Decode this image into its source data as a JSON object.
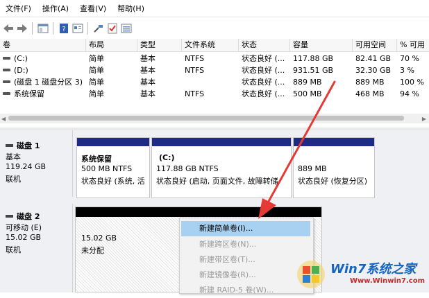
{
  "menu": [
    "文件(F)",
    "操作(A)",
    "查看(V)",
    "帮助(H)"
  ],
  "volume_table": {
    "columns": [
      "卷",
      "布局",
      "类型",
      "文件系统",
      "状态",
      "容量",
      "可用空间",
      "% 可用"
    ],
    "rows": [
      {
        "name": "(C:)",
        "layout": "简单",
        "type": "基本",
        "fs": "NTFS",
        "status": "状态良好 (...",
        "capacity": "117.88 GB",
        "free": "82.41 GB",
        "pct": "70 %"
      },
      {
        "name": "(D:)",
        "layout": "简单",
        "type": "基本",
        "fs": "NTFS",
        "status": "状态良好 (...",
        "capacity": "931.51 GB",
        "free": "32.30 GB",
        "pct": "3 %"
      },
      {
        "name": "(磁盘 1 磁盘分区 3)",
        "layout": "简单",
        "type": "基本",
        "fs": "",
        "status": "状态良好 (...",
        "capacity": "889 MB",
        "free": "889 MB",
        "pct": "100 %"
      },
      {
        "name": "系统保留",
        "layout": "简单",
        "type": "基本",
        "fs": "NTFS",
        "status": "状态良好 (...",
        "capacity": "500 MB",
        "free": "468 MB",
        "pct": "94 %"
      }
    ]
  },
  "disk1": {
    "name": "磁盘 1",
    "type": "基本",
    "size": "119.24 GB",
    "state": "联机",
    "partitions": [
      {
        "name": "系统保留",
        "size": "500 MB NTFS",
        "status": "状态良好 (系统, 活"
      },
      {
        "name": "(C:)",
        "size": "117.88 GB NTFS",
        "status": "状态良好 (启动, 页面文件, 故障转储"
      },
      {
        "name": "",
        "size": "889 MB",
        "status": "状态良好 (恢复分区)"
      }
    ]
  },
  "disk2": {
    "name": "磁盘 2",
    "type": "可移动 (E)",
    "size": "15.02 GB",
    "state": "联机",
    "unallocated": {
      "size": "15.02 GB",
      "label": "未分配"
    }
  },
  "context_menu": {
    "items": [
      {
        "label": "新建简单卷(I)...",
        "state": "selected"
      },
      {
        "label": "新建跨区卷(N)...",
        "state": "disabled"
      },
      {
        "label": "新建带区卷(T)...",
        "state": "disabled"
      },
      {
        "label": "新建镜像卷(R)...",
        "state": "disabled"
      },
      {
        "label": "新建 RAID-5 卷(W)...",
        "state": "disabled"
      }
    ]
  },
  "watermark": {
    "brand": "Win7系统之家",
    "url": "Www.Winwin7.com"
  },
  "colors": {
    "partition_header": "#1e2a84",
    "unallocated_header": "#000000",
    "selected_item": "#a8d0f0",
    "annotation_arrow": "#e53935"
  }
}
